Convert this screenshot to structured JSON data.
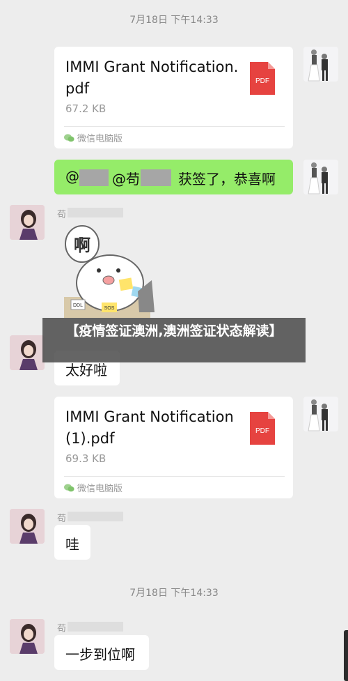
{
  "timestamps": [
    "7月18日 下午14:33",
    "7月18日 下午14:33"
  ],
  "messages": {
    "file1": {
      "name": "IMMI Grant Notification.pdf",
      "size": "67.2 KB",
      "source": "微信电脑版",
      "icon_label": "PDF"
    },
    "mention": {
      "prefix": "@",
      "second_prefix": "@苟",
      "text": "获签了，恭喜啊"
    },
    "friend_name_initial": "苟",
    "sticker_text": "啊",
    "sticker_labels": [
      "DDL",
      "SOS"
    ],
    "taihaola": "太好啦",
    "file2": {
      "name": "IMMI Grant Notification (1).pdf",
      "size": "69.3 KB",
      "source": "微信电脑版",
      "icon_label": "PDF"
    },
    "wa": "哇",
    "yibu": "一步到位啊"
  },
  "banner": {
    "text": "【疫情签证澳洲,澳洲签证状态解读】"
  },
  "colors": {
    "background": "#ededed",
    "sent_bubble": "#95ec69",
    "received_bubble": "#ffffff",
    "pdf_red": "#e64340",
    "banner_bg": "#484848"
  }
}
